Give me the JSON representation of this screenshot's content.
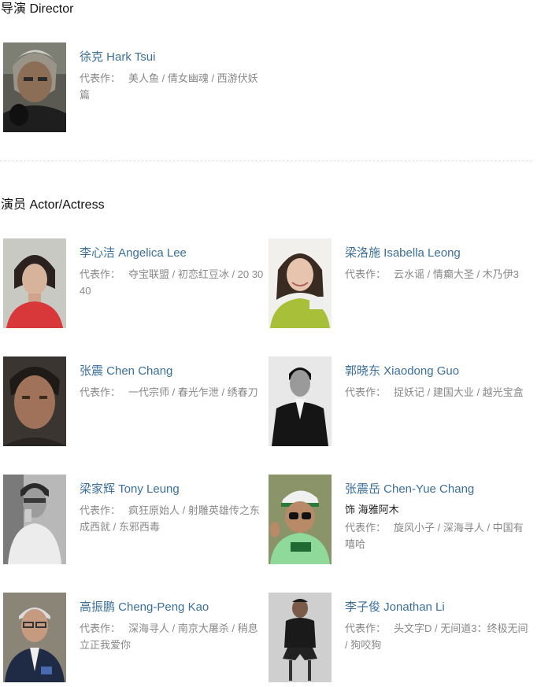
{
  "director_section": {
    "title": "导演 Director",
    "people": [
      {
        "name": "徐克 Hark Tsui",
        "works_label": "代表作：",
        "works": "美人鱼 / 倩女幽魂 / 西游伏妖篇",
        "role": ""
      }
    ]
  },
  "actor_section": {
    "title": "演员 Actor/Actress",
    "people": [
      {
        "name": "李心洁 Angelica Lee",
        "works_label": "代表作：",
        "works": "夺宝联盟 / 初恋红豆冰 / 20 30 40",
        "role": ""
      },
      {
        "name": "梁洛施 Isabella Leong",
        "works_label": "代表作：",
        "works": "云水谣 / 情癫大圣 / 木乃伊3",
        "role": ""
      },
      {
        "name": "张震 Chen Chang",
        "works_label": "代表作：",
        "works": "一代宗师 / 春光乍泄 / 绣春刀",
        "role": ""
      },
      {
        "name": "郭晓东 Xiaodong Guo",
        "works_label": "代表作：",
        "works": "捉妖记 / 建国大业 / 越光宝盒",
        "role": ""
      },
      {
        "name": "梁家辉 Tony Leung",
        "works_label": "代表作：",
        "works": "疯狂原始人 / 射雕英雄传之东成西就 / 东邪西毒",
        "role": ""
      },
      {
        "name": "张震岳 Chen-Yue Chang",
        "works_label": "代表作：",
        "works": "旋风小子 / 深海寻人 / 中国有嘻哈",
        "role": "饰 海雅阿木"
      },
      {
        "name": "高振鹏 Cheng-Peng Kao",
        "works_label": "代表作：",
        "works": "深海寻人 / 南京大屠杀 / 稍息立正我爱你",
        "role": ""
      },
      {
        "name": "李子俊 Jonathan Li",
        "works_label": "代表作：",
        "works": "头文字D / 无间道3：终极无间 / 狗咬狗",
        "role": ""
      }
    ]
  },
  "colors": {
    "name_link": "#3b6f9a",
    "works_text": "#888888",
    "divider": "#dddddd"
  }
}
